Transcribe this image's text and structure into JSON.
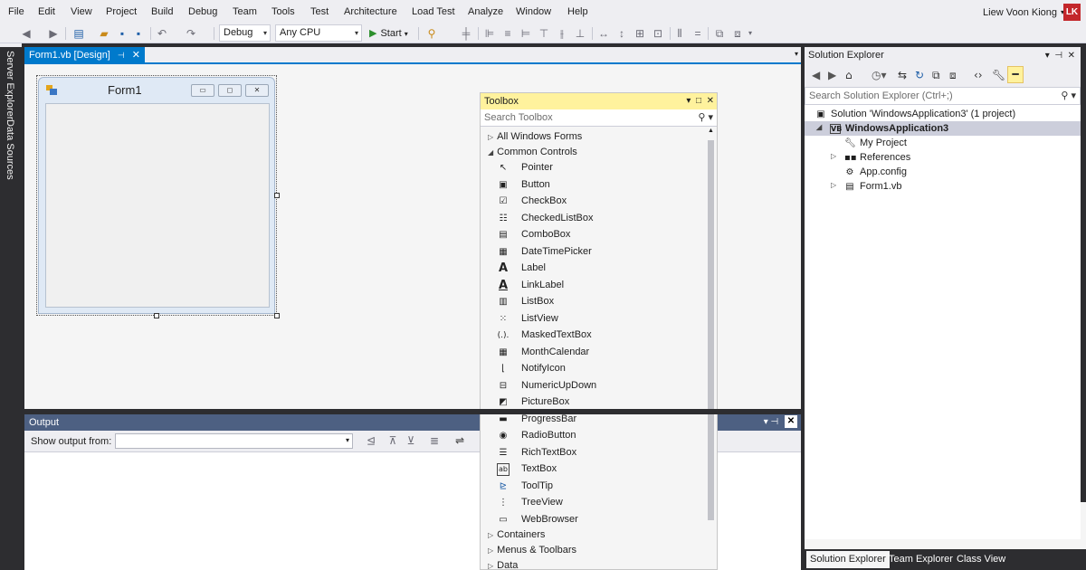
{
  "menu": [
    "File",
    "Edit",
    "View",
    "Project",
    "Build",
    "Debug",
    "Team",
    "Tools",
    "Test",
    "Architecture",
    "Load Test",
    "Analyze",
    "Window",
    "Help"
  ],
  "user": {
    "name": "Liew Voon Kiong",
    "initials": "LK"
  },
  "toolbar": {
    "config_value": "Debug",
    "platform_value": "Any CPU",
    "start_label": "Start"
  },
  "side_tabs": {
    "server_explorer": "Server Explorer",
    "data_sources": "Data Sources"
  },
  "document": {
    "tab_label": "Form1.vb [Design]"
  },
  "form": {
    "title": "Form1"
  },
  "output": {
    "title": "Output",
    "show_from_label": "Show output from:",
    "show_from_value": ""
  },
  "toolbox": {
    "title": "Toolbox",
    "search_placeholder": "Search Toolbox",
    "categories_top": [
      "All Windows Forms",
      "Common Controls"
    ],
    "items": [
      {
        "label": "Pointer",
        "icon": "pointer-icon"
      },
      {
        "label": "Button",
        "icon": "button-icon"
      },
      {
        "label": "CheckBox",
        "icon": "checkbox-icon"
      },
      {
        "label": "CheckedListBox",
        "icon": "checkedlistbox-icon"
      },
      {
        "label": "ComboBox",
        "icon": "combobox-icon"
      },
      {
        "label": "DateTimePicker",
        "icon": "datetimepicker-icon"
      },
      {
        "label": "Label",
        "icon": "label-icon"
      },
      {
        "label": "LinkLabel",
        "icon": "linklabel-icon"
      },
      {
        "label": "ListBox",
        "icon": "listbox-icon"
      },
      {
        "label": "ListView",
        "icon": "listview-icon"
      },
      {
        "label": "MaskedTextBox",
        "icon": "maskedtextbox-icon"
      },
      {
        "label": "MonthCalendar",
        "icon": "monthcalendar-icon"
      },
      {
        "label": "NotifyIcon",
        "icon": "notifyicon-icon"
      },
      {
        "label": "NumericUpDown",
        "icon": "numericupdown-icon"
      },
      {
        "label": "PictureBox",
        "icon": "picturebox-icon"
      },
      {
        "label": "ProgressBar",
        "icon": "progressbar-icon"
      },
      {
        "label": "RadioButton",
        "icon": "radiobutton-icon"
      },
      {
        "label": "RichTextBox",
        "icon": "richtextbox-icon"
      },
      {
        "label": "TextBox",
        "icon": "textbox-icon"
      },
      {
        "label": "ToolTip",
        "icon": "tooltip-icon"
      },
      {
        "label": "TreeView",
        "icon": "treeview-icon"
      },
      {
        "label": "WebBrowser",
        "icon": "webbrowser-icon"
      }
    ],
    "categories_bottom": [
      "Containers",
      "Menus & Toolbars",
      "Data"
    ]
  },
  "solution_explorer": {
    "title": "Solution Explorer",
    "search_placeholder": "Search Solution Explorer (Ctrl+;)",
    "solution_label": "Solution 'WindowsApplication3' (1 project)",
    "project_label": "WindowsApplication3",
    "children": [
      "My Project",
      "References",
      "App.config",
      "Form1.vb"
    ]
  },
  "bottom_tabs": [
    "Solution Explorer",
    "Team Explorer",
    "Class View"
  ]
}
